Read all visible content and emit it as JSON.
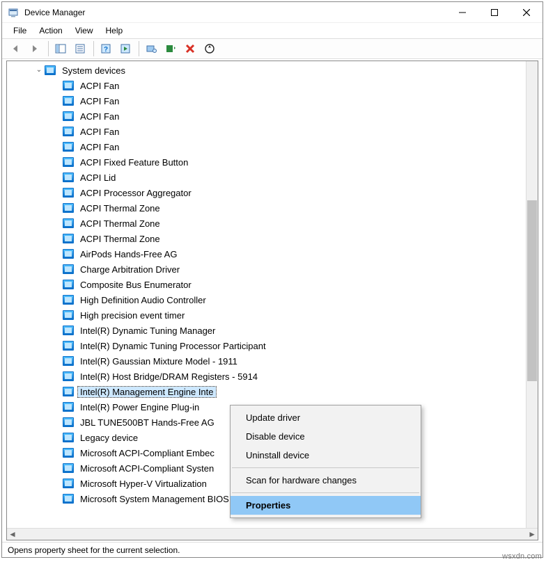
{
  "window": {
    "title": "Device Manager"
  },
  "menubar": {
    "items": [
      "File",
      "Action",
      "View",
      "Help"
    ]
  },
  "toolbar": {
    "icons": [
      "back-icon",
      "forward-icon",
      "show-hide-tree-icon",
      "properties-icon",
      "help-icon",
      "action-icon",
      "show-hidden-devices-icon",
      "update-driver-icon",
      "uninstall-icon",
      "scan-hardware-icon"
    ]
  },
  "tree": {
    "root": {
      "label": "System devices",
      "expanded": true,
      "children": [
        "ACPI Fan",
        "ACPI Fan",
        "ACPI Fan",
        "ACPI Fan",
        "ACPI Fan",
        "ACPI Fixed Feature Button",
        "ACPI Lid",
        "ACPI Processor Aggregator",
        "ACPI Thermal Zone",
        "ACPI Thermal Zone",
        "ACPI Thermal Zone",
        "AirPods Hands-Free AG",
        "Charge Arbitration Driver",
        "Composite Bus Enumerator",
        "High Definition Audio Controller",
        "High precision event timer",
        "Intel(R) Dynamic Tuning Manager",
        "Intel(R) Dynamic Tuning Processor Participant",
        "Intel(R) Gaussian Mixture Model - 1911",
        "Intel(R) Host Bridge/DRAM Registers - 5914",
        "Intel(R) Management Engine Inte",
        "Intel(R) Power Engine Plug-in",
        "JBL TUNE500BT Hands-Free AG",
        "Legacy device",
        "Microsoft ACPI-Compliant Embec",
        "Microsoft ACPI-Compliant Systen",
        "Microsoft Hyper-V Virtualization",
        "Microsoft System Management BIOS Driver"
      ],
      "selected_index": 20
    }
  },
  "context_menu": {
    "items": [
      {
        "label": "Update driver",
        "type": "item"
      },
      {
        "label": "Disable device",
        "type": "item"
      },
      {
        "label": "Uninstall device",
        "type": "item"
      },
      {
        "type": "sep"
      },
      {
        "label": "Scan for hardware changes",
        "type": "item"
      },
      {
        "type": "sep"
      },
      {
        "label": "Properties",
        "type": "item",
        "highlight": true
      }
    ]
  },
  "statusbar": {
    "text": "Opens property sheet for the current selection."
  },
  "watermark": "wsxdn.com"
}
